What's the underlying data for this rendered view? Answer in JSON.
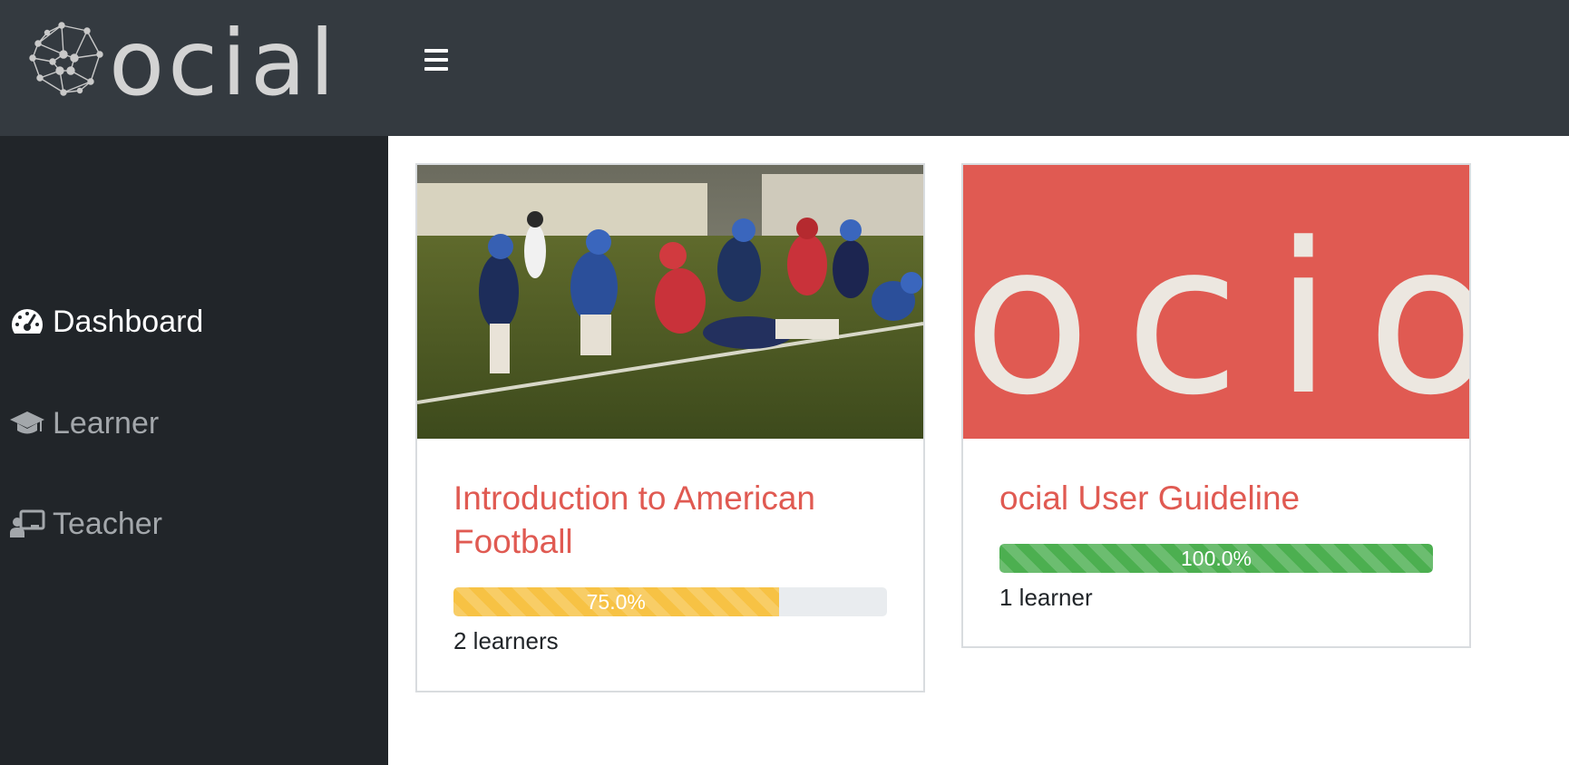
{
  "header": {
    "logo_text": "ocial",
    "menu_icon": "hamburger-icon"
  },
  "sidebar": {
    "items": [
      {
        "label": "Dashboard",
        "icon": "dashboard-gauge-icon",
        "active": true
      },
      {
        "label": "Learner",
        "icon": "graduation-cap-icon",
        "active": false
      },
      {
        "label": "Teacher",
        "icon": "chalkboard-teacher-icon",
        "active": false
      }
    ]
  },
  "courses": [
    {
      "title": "Introduction to American Football",
      "progress_label": "75.0%",
      "progress": 0.75,
      "progress_color": "#f7c244",
      "learners": "2 learners",
      "image": "american-football-photo"
    },
    {
      "title": "ocial User Guideline",
      "progress_label": "100.0%",
      "progress": 1.0,
      "progress_color": "#4caf50",
      "learners": "1 learner",
      "image": "ocial-banner",
      "banner_text": "ocio",
      "banner_color": "#e05a52"
    }
  ],
  "colors": {
    "accent": "#e05a52",
    "topbar": "#343a40",
    "sidebar": "#212529"
  }
}
